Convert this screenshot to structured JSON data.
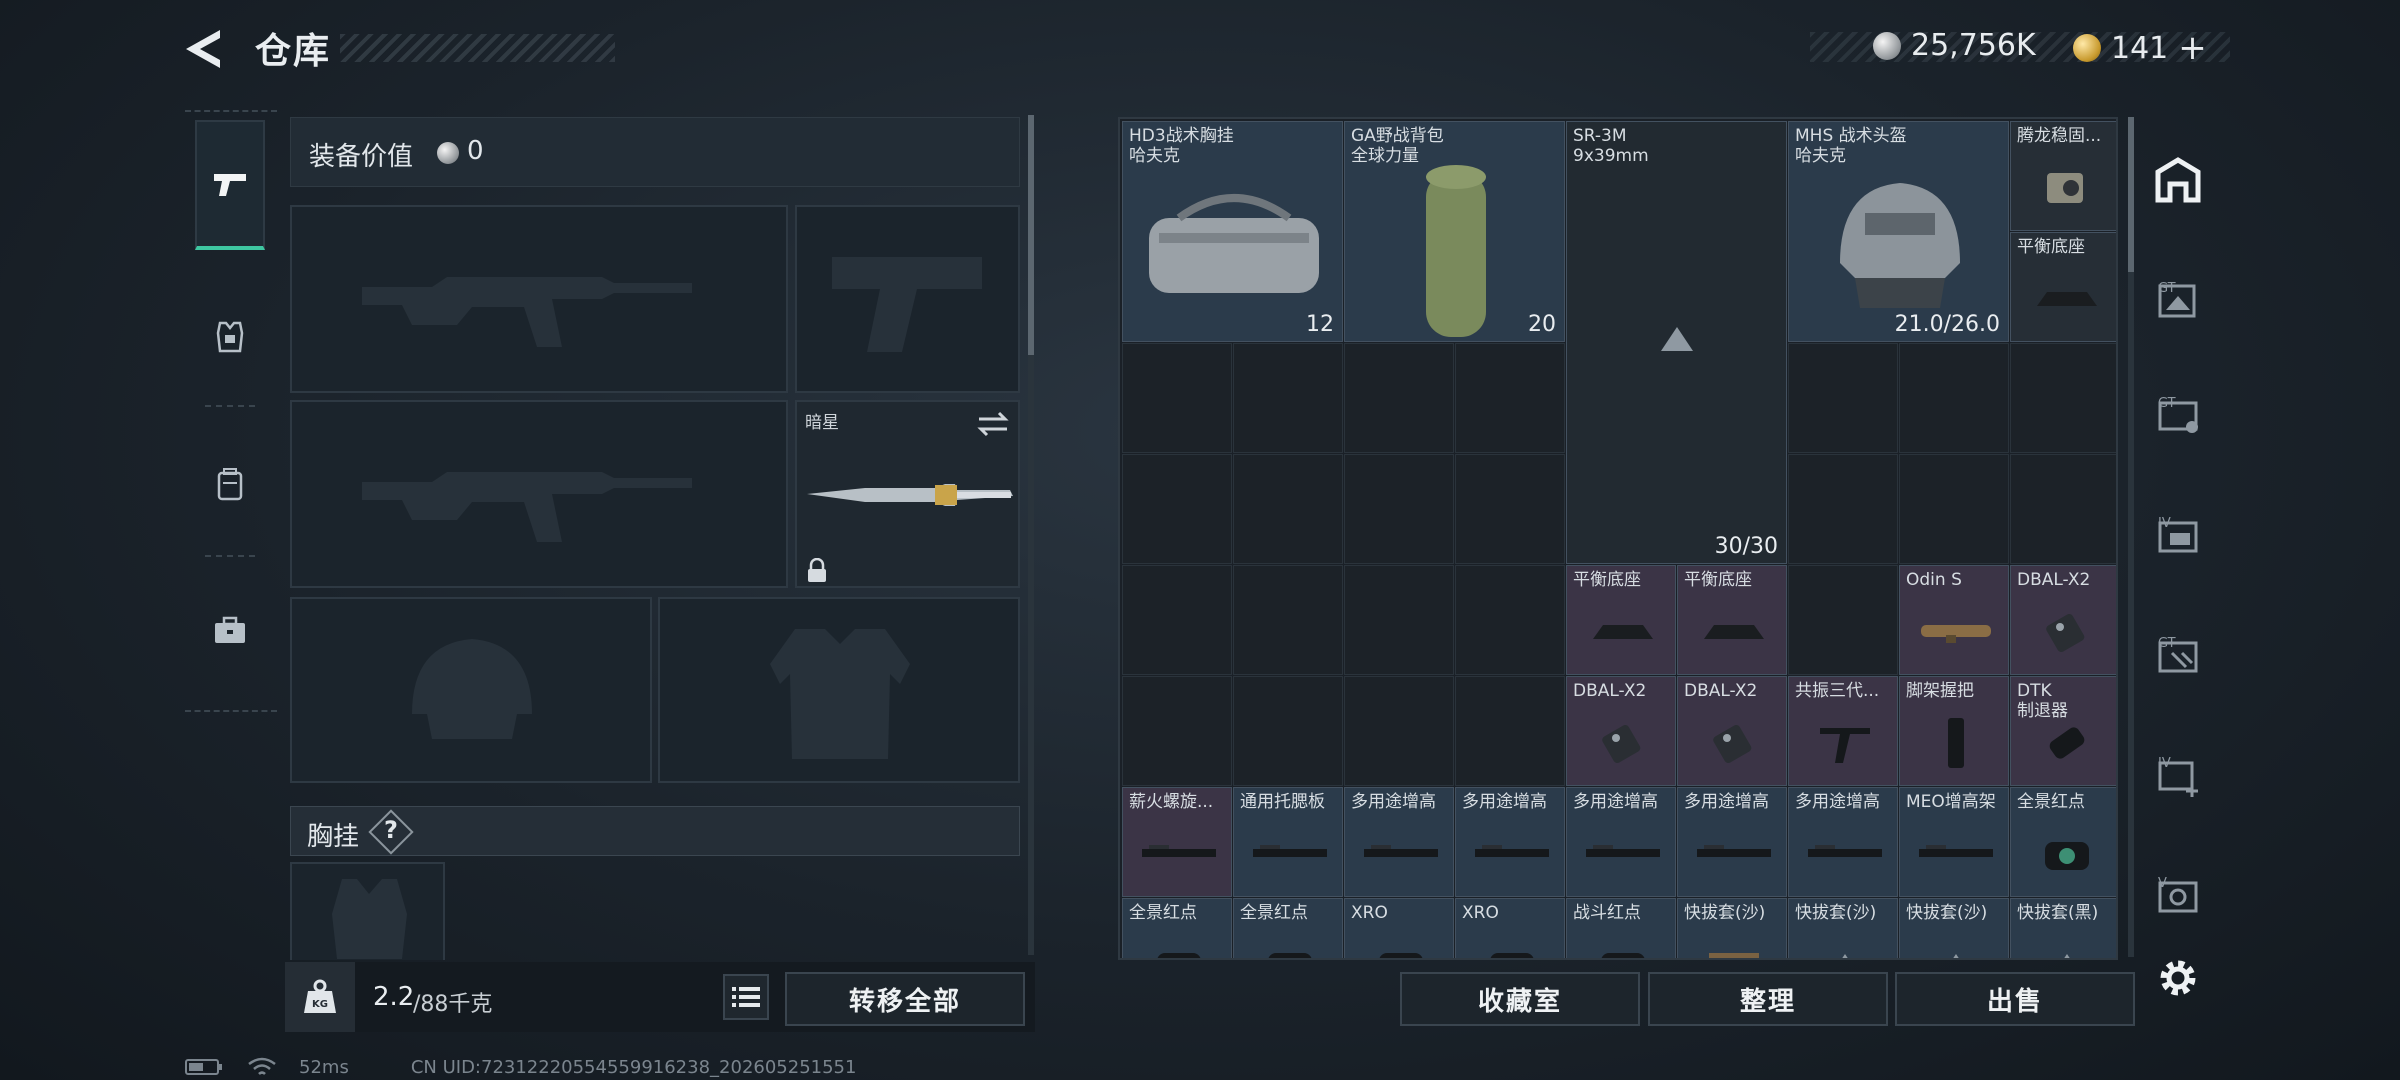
{
  "header": {
    "title": "仓库",
    "silver": "25,756K",
    "gold": "141",
    "gold_plus": "+"
  },
  "loadout": {
    "value_label": "装备价值",
    "value": "0",
    "melee_name": "暗星",
    "chest_label": "胸挂",
    "chest_help": "?",
    "weight_value": "2.2",
    "weight_capacity": "/88千克",
    "transfer_all": "转移全部"
  },
  "grid": {
    "items": [
      {
        "name": "HD3战术胸挂",
        "sub": "哈夫克",
        "count": "12"
      },
      {
        "name": "GA野战背包",
        "sub": "全球力量",
        "count": "20"
      },
      {
        "name": "SR-3M",
        "sub": "9x39mm",
        "count": "30/30"
      },
      {
        "name": "MHS 战术头盔",
        "sub": "哈夫克",
        "count": "21.0/26.0"
      },
      {
        "name": "腾龙稳固..."
      },
      {
        "name": "平衡底座"
      },
      {
        "name": "平衡底座"
      },
      {
        "name": "平衡底座"
      },
      {
        "name": "Odin S"
      },
      {
        "name": "DBAL-X2"
      },
      {
        "name": "DBAL-X2"
      },
      {
        "name": "DBAL-X2"
      },
      {
        "name": "共振三代..."
      },
      {
        "name": "脚架握把"
      },
      {
        "name": "DTK",
        "sub": "制退器"
      },
      {
        "name": "薪火螺旋..."
      },
      {
        "name": "通用托腮板"
      },
      {
        "name": "多用途增高"
      },
      {
        "name": "多用途增高"
      },
      {
        "name": "多用途增高"
      },
      {
        "name": "多用途增高"
      },
      {
        "name": "多用途增高"
      },
      {
        "name": "MEO增高架"
      },
      {
        "name": "全景红点"
      },
      {
        "name": "全景红点"
      },
      {
        "name": "全景红点"
      },
      {
        "name": "XRO"
      },
      {
        "name": "XRO"
      },
      {
        "name": "战斗红点"
      },
      {
        "name": "快拔套(沙)"
      },
      {
        "name": "快拔套(沙)"
      },
      {
        "name": "快拔套(沙)"
      },
      {
        "name": "快拔套(黑)"
      }
    ]
  },
  "actions": {
    "collection": "收藏室",
    "sort": "整理",
    "sell": "出售"
  },
  "status": {
    "ping": "52ms",
    "uid": "CN UID:72312220554559916238_202605251551"
  },
  "colors": {
    "accent": "#3ec7a1",
    "blue_item": "#2b3b4b",
    "purple_item": "#3b3446"
  }
}
